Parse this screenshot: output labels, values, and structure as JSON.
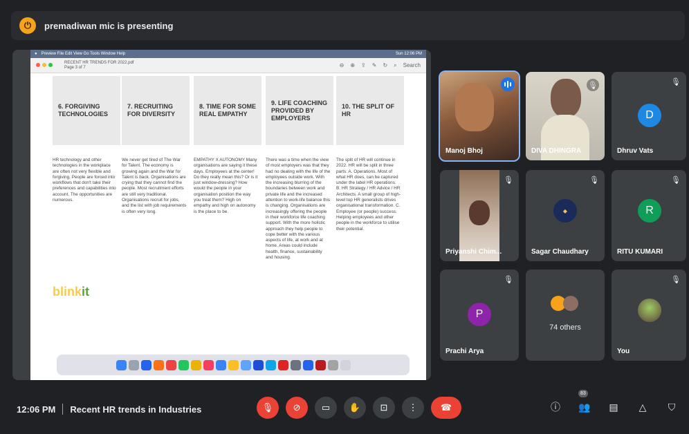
{
  "top": {
    "presenting": "premadiwan mic is presenting"
  },
  "pdf": {
    "menubar_left": "Preview  File  Edit  View  Go  Tools  Window  Help",
    "menubar_right": "Sun 12:06 PM",
    "file_title": "RECENT HR TRENDS FOR 2022.pdf",
    "file_sub": "Page 3 of 7",
    "search": "Search"
  },
  "columns": [
    {
      "heading": "6. FORGIVING TECHNOLOGIES",
      "body": "HR technology and other technologies in the workplace are often not very flexible and forgiving. People are forced into workflows that don't take their preferences and capabilities into account. The opportunities are numerous."
    },
    {
      "heading": "7. RECRUITING FOR DIVERSITY",
      "body": "We never get tired of The War for Talent. The economy is growing again and the War for Talent is back. Organisations are crying that they cannot find the people. Most recruitment efforts are still very traditional. Organisations recruit for jobs, and the list with job requirements is often very long."
    },
    {
      "heading": "8. TIME FOR SOME REAL EMPATHY",
      "body": "EMPATHY X AUTONOMY Many organisations are saying it these days. Employees at the center! Do they really mean this? Or is it just window-dressing? How would the people in your organisation position the way you treat them? High on empathy and high on autonomy is the place to be."
    },
    {
      "heading": "9. LIFE COACHING PROVIDED BY EMPLOYERS",
      "body": "There was a time when the view of most employers was that they had no dealing with the life of the employees outside work. With the increasing blurring of the boundaries between work and private life and the increased attention to work-life balance this is changing. Organisations are increasingly offering the people in their workforce life coaching support. With the more holistic approach they help people to cope better with the various aspects of life, at work and at home. Areas could include health, finance, sustainability and housing."
    },
    {
      "heading": "10. THE SPLIT OF HR",
      "body": "The split of HR will continue in 2022. HR will be split in three parts: A. Operations. Most of what HR does, can be captured under the label HR operations. B. HR Strategy / HR Advice / HR Architects. A small group of high-level top HR generalists drives organisational transformation. C. Employee (or people) success. Helping employees and other people in the workforce to utilise their potential."
    }
  ],
  "logo_text": {
    "part1": "blink",
    "part2": "it"
  },
  "participants": [
    {
      "name": "Manoj Bhoj",
      "avatar": ""
    },
    {
      "name": "DIVA DHINGRA",
      "avatar": ""
    },
    {
      "name": "Dhruv Vats",
      "avatar": "D"
    },
    {
      "name": "Priyanshi Chim...",
      "avatar": ""
    },
    {
      "name": "Sagar Chaudhary",
      "avatar": ""
    },
    {
      "name": "RITU KUMARI",
      "avatar": "R"
    },
    {
      "name": "Prachi Arya",
      "avatar": "P"
    },
    {
      "name": "74 others",
      "avatar": ""
    },
    {
      "name": "You",
      "avatar": ""
    }
  ],
  "colors": {
    "accent_blue": "#1a73e8",
    "end_red": "#ea4335",
    "presenter_orange": "#f6a21a",
    "avatar_D": "#1e88e5",
    "avatar_R": "#0f9d58",
    "avatar_P": "#8e24aa"
  },
  "bottom": {
    "time": "12:06 PM",
    "meeting": "Recent HR trends in Industries",
    "people_count": "83"
  },
  "icons": {
    "mic_off": "mic-off-icon",
    "cam_off": "camera-off-icon",
    "captions": "captions-icon",
    "hand": "raise-hand-icon",
    "present": "present-icon",
    "more": "more-vert-icon",
    "end": "call-end-icon",
    "info": "info-icon",
    "people": "people-icon",
    "chat": "chat-icon",
    "activities": "activities-icon",
    "host": "host-controls-icon"
  }
}
